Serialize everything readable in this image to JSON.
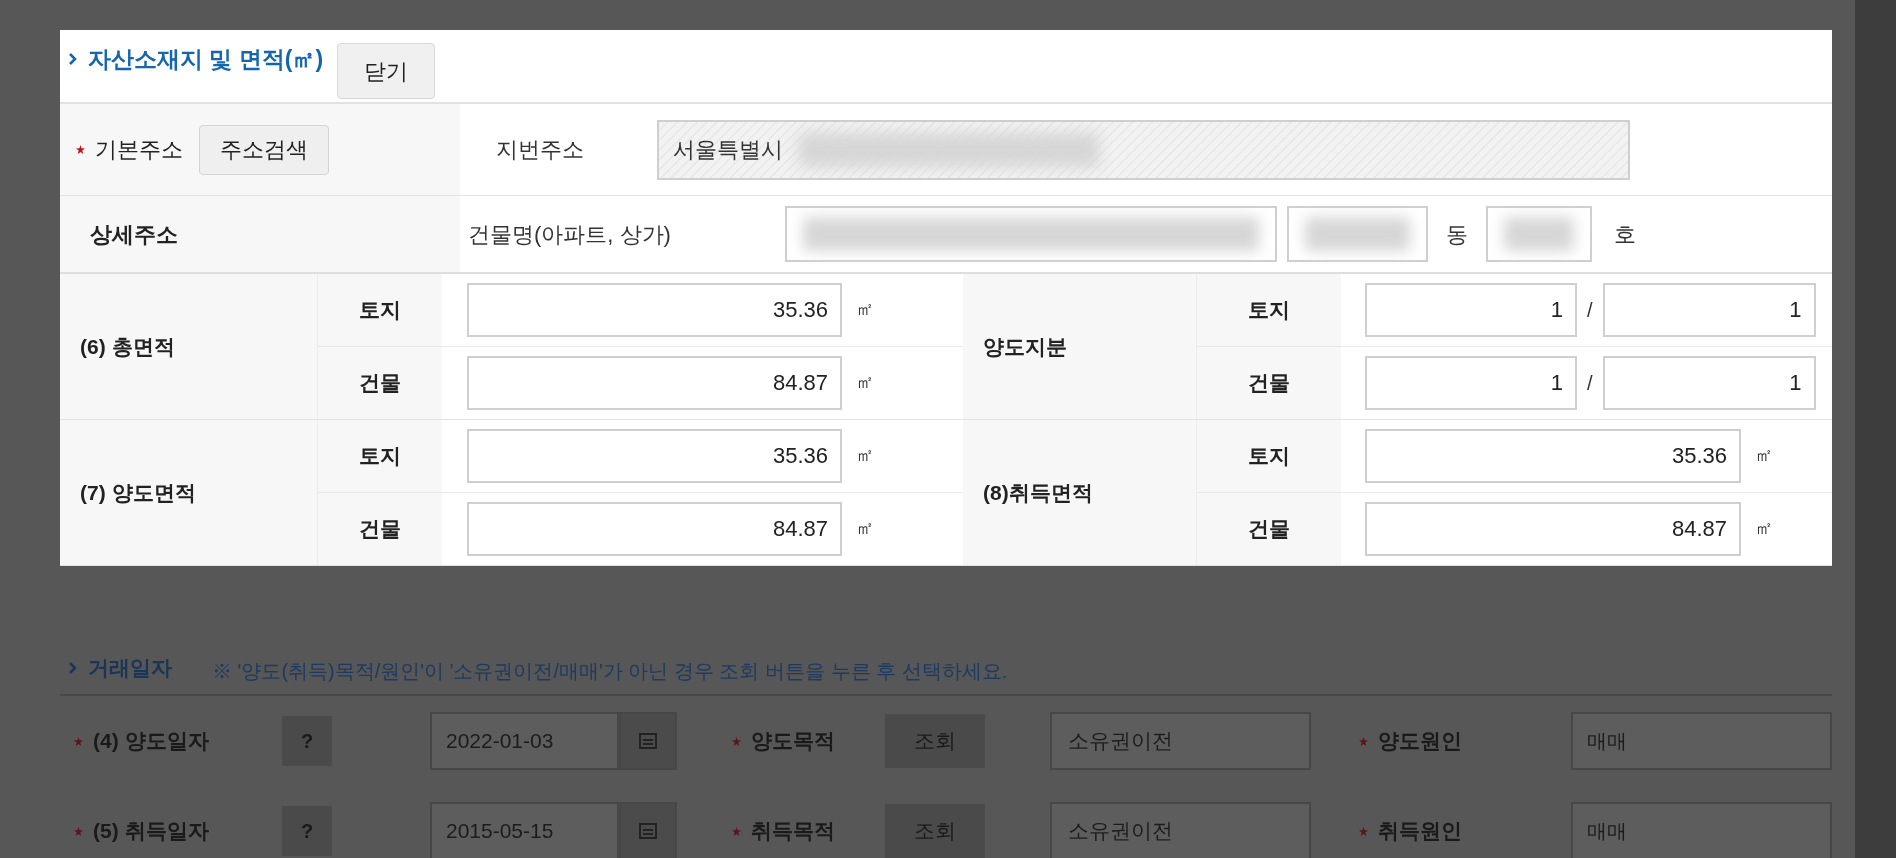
{
  "section": {
    "title": "자산소재지 및 면적(㎡)",
    "close_button": "닫기"
  },
  "address": {
    "basic_label": "기본주소",
    "basic_required": true,
    "search_button": "주소검색",
    "lot_label": "지번주소",
    "lot_value": "서울특별시",
    "lot_redacted": true,
    "detail_label": "상세주소",
    "building_label": "건물명(아파트, 상가)",
    "building_redacted": true,
    "dong_redacted": true,
    "dong_unit": "동",
    "ho_redacted": true,
    "ho_unit": "호"
  },
  "area_blocks": [
    {
      "kind": "area",
      "label": "(6) 총면적",
      "rows": [
        {
          "label": "토지",
          "value": "35.36",
          "unit": "㎡"
        },
        {
          "label": "건물",
          "value": "84.87",
          "unit": "㎡"
        }
      ]
    },
    {
      "kind": "share",
      "label": "양도지분",
      "rows": [
        {
          "label": "토지",
          "numerator": "1",
          "separator": "/",
          "denominator": "1"
        },
        {
          "label": "건물",
          "numerator": "1",
          "separator": "/",
          "denominator": "1"
        }
      ]
    },
    {
      "kind": "area",
      "label": "(7) 양도면적",
      "rows": [
        {
          "label": "토지",
          "value": "35.36",
          "unit": "㎡"
        },
        {
          "label": "건물",
          "value": "84.87",
          "unit": "㎡"
        }
      ]
    },
    {
      "kind": "area",
      "label": "(8)취득면적",
      "rows": [
        {
          "label": "토지",
          "value": "35.36",
          "unit": "㎡"
        },
        {
          "label": "건물",
          "value": "84.87",
          "unit": "㎡"
        }
      ]
    }
  ],
  "trade": {
    "title": "거래일자",
    "note": "※ '양도(취득)목적/원인'이 '소유권이전/매매'가 아닌 경우 조회 버튼을 누른 후 선택하세요.",
    "rows": [
      {
        "required": true,
        "date_label": "(4) 양도일자",
        "help_button": "?",
        "date": "2022-01-03",
        "purpose_label": "양도목적",
        "lookup_button": "조회",
        "purpose": "소유권이전",
        "cause_label": "양도원인",
        "cause": "매매"
      },
      {
        "required": true,
        "date_label": "(5) 취득일자",
        "help_button": "?",
        "date": "2015-05-15",
        "purpose_label": "취득목적",
        "lookup_button": "조회",
        "purpose": "소유권이전",
        "cause_label": "취득원인",
        "cause": "매매"
      }
    ]
  }
}
